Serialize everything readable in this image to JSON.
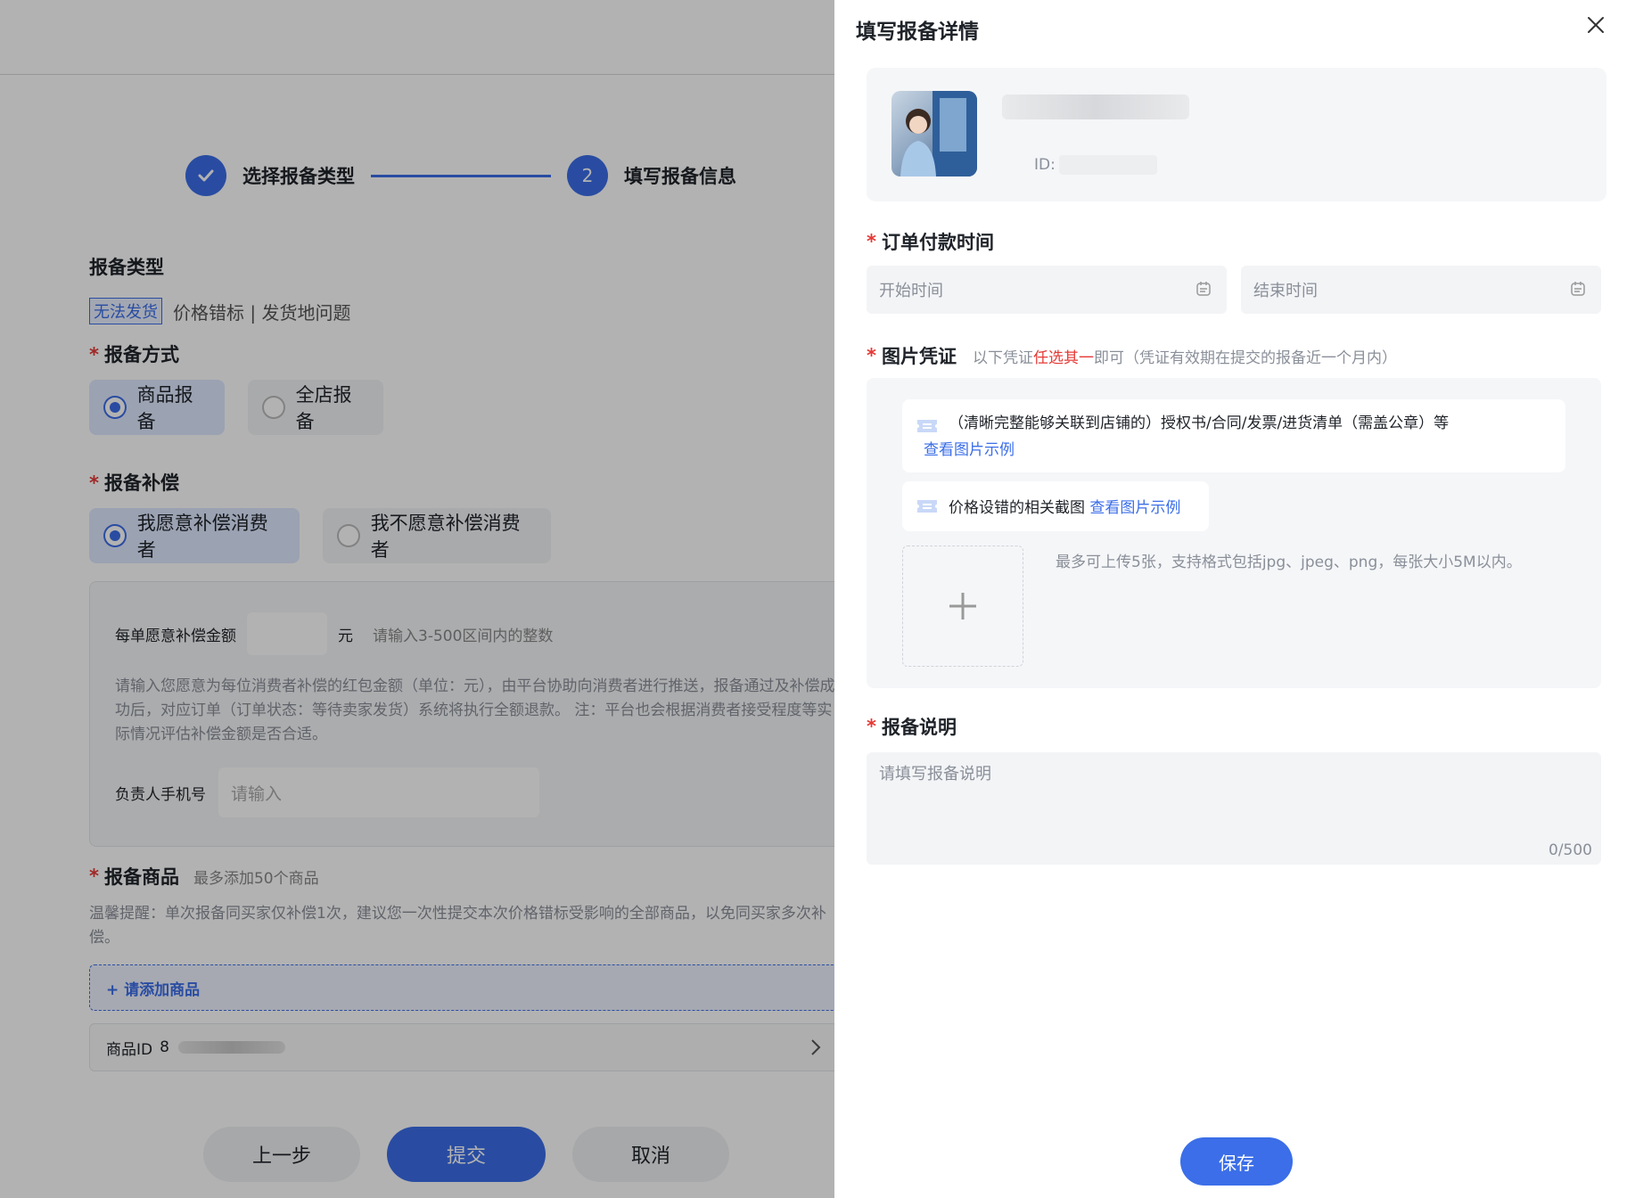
{
  "steps": [
    {
      "label": "选择报备类型",
      "state": "done"
    },
    {
      "label": "填写报备信息",
      "number": "2",
      "state": "active"
    }
  ],
  "report_type": {
    "title": "报备类型",
    "tag": "无法发货",
    "value": "价格错标 | 发货地问题"
  },
  "report_method": {
    "title": "报备方式",
    "options": [
      {
        "label": "商品报备",
        "selected": true
      },
      {
        "label": "全店报备",
        "selected": false
      }
    ]
  },
  "report_compensation": {
    "title": "报备补偿",
    "options": [
      {
        "label": "我愿意补偿消费者",
        "selected": true
      },
      {
        "label": "我不愿意补偿消费者",
        "selected": false
      }
    ],
    "amount_label": "每单愿意补偿金额",
    "amount_unit": "元",
    "amount_hint": "请输入3-500区间内的整数",
    "description": "请输入您愿意为每位消费者补偿的红包金额（单位：元），由平台协助向消费者进行推送，报备通过及补偿成功后，对应订单（订单状态：等待卖家发货）系统将执行全额退款。 注：平台也会根据消费者接受程度等实际情况评估补偿金额是否合适。",
    "phone_label": "负责人手机号",
    "phone_placeholder": "请输入"
  },
  "report_goods": {
    "title": "报备商品",
    "limit": "最多添加50个商品",
    "tip": "温馨提醒：单次报备同买家仅补偿1次，建议您一次性提交本次价格错标受影响的全部商品，以免同买家多次补偿。",
    "add_label": "+ 请添加商品",
    "goods_id_label": "商品ID",
    "goods_id_value": "8"
  },
  "footer_buttons": {
    "prev": "上一步",
    "submit": "提交",
    "cancel": "取消"
  },
  "drawer": {
    "title": "填写报备详情",
    "store": {
      "id_label": "ID:"
    },
    "pay_time": {
      "label": "订单付款时间",
      "start_placeholder": "开始时间",
      "end_placeholder": "结束时间"
    },
    "evidence": {
      "label": "图片凭证",
      "hint_prefix": "以下凭证",
      "hint_highlight": "任选其一",
      "hint_suffix": "即可（凭证有效期在提交的报备近一个月内）",
      "item1_text": "（清晰完整能够关联到店铺的）授权书/合同/发票/进货清单（需盖公章）等",
      "item1_link": "查看图片示例",
      "item2_text": "价格设错的相关截图",
      "item2_link": "查看图片示例",
      "upload_hint": "最多可上传5张，支持格式包括jpg、jpeg、png，每张大小5M以内。"
    },
    "note": {
      "label": "报备说明",
      "placeholder": "请填写报备说明",
      "count": "0/500"
    },
    "save_label": "保存"
  },
  "colors": {
    "primary": "#3b6ee8",
    "required": "#e53935",
    "overlay": "rgba(0,0,0,0.30)"
  }
}
